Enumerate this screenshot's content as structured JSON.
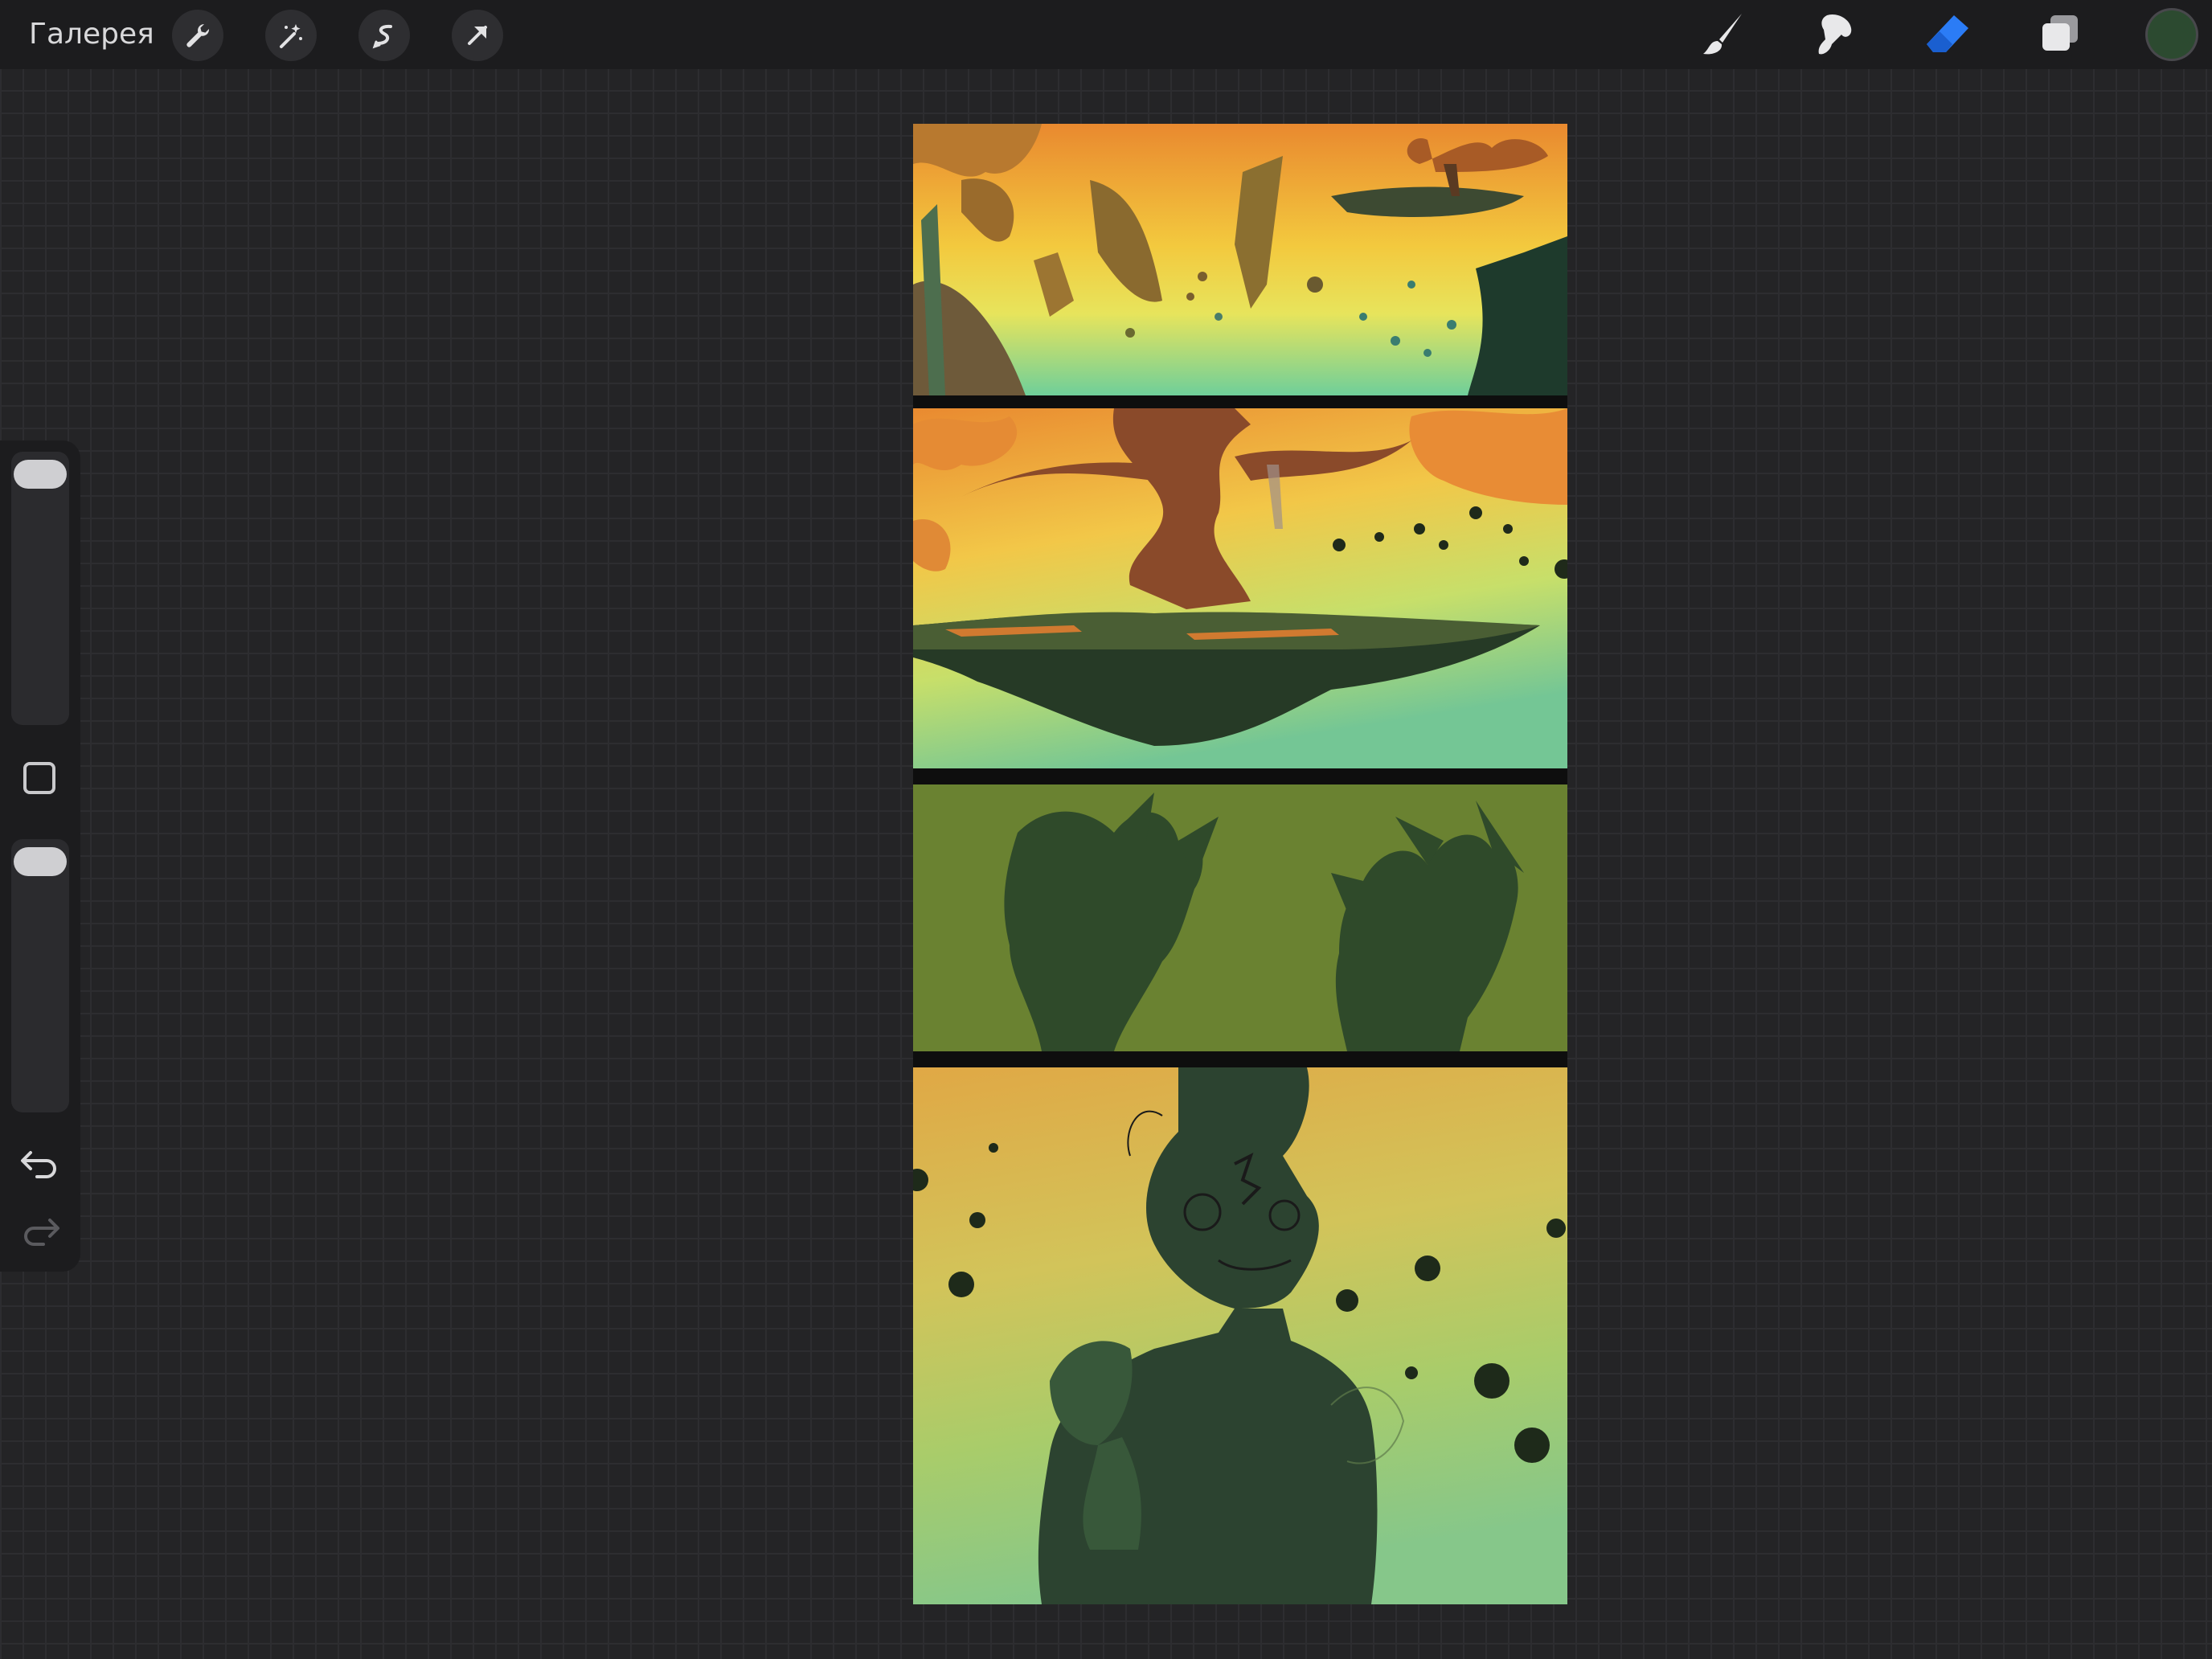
{
  "app": {
    "gallery_label": "Галерея"
  },
  "toolbar_left": {
    "icons": [
      "wrench-icon",
      "magic-wand-icon",
      "selection-icon",
      "transform-arrow-icon"
    ]
  },
  "toolbar_right": {
    "icons": [
      "brush-icon",
      "smudge-icon",
      "eraser-icon",
      "layers-icon"
    ],
    "active_tool": "eraser",
    "active_color": "#2c4a30",
    "accent_color": "#2b7cf6"
  },
  "sidebar": {
    "brush_size_level": 0.98,
    "opacity_level": 0.98,
    "icons": [
      "modify-square-icon",
      "undo-icon",
      "redo-icon"
    ]
  },
  "canvas": {
    "panel_count": 4,
    "panels": [
      "floating-islands-sky",
      "tree-on-floating-island",
      "claw-hands-silhouette",
      "dragon-character"
    ]
  }
}
